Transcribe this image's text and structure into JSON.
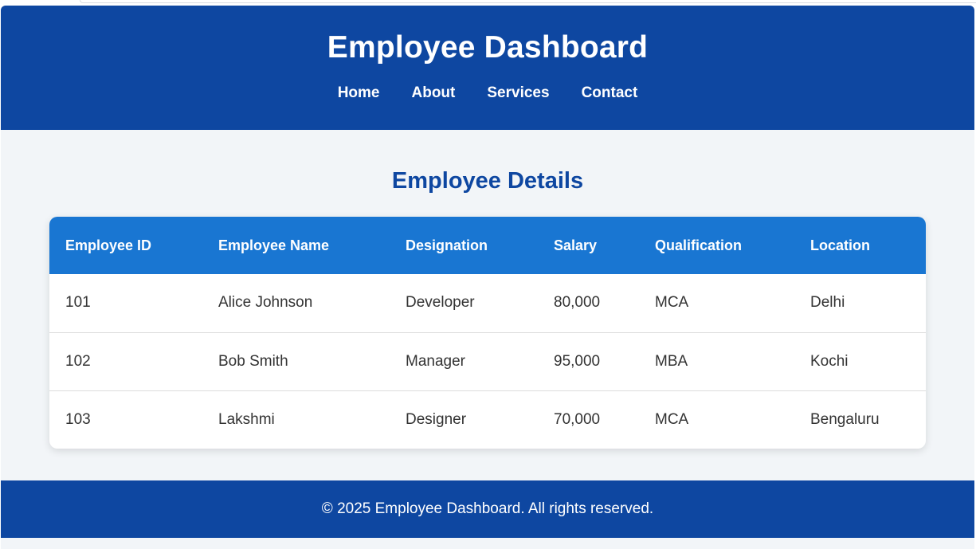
{
  "header": {
    "title": "Employee Dashboard",
    "nav": [
      {
        "label": "Home"
      },
      {
        "label": "About"
      },
      {
        "label": "Services"
      },
      {
        "label": "Contact"
      }
    ]
  },
  "main": {
    "section_title": "Employee Details",
    "table": {
      "columns": [
        "Employee ID",
        "Employee Name",
        "Designation",
        "Salary",
        "Qualification",
        "Location"
      ],
      "rows": [
        [
          "101",
          "Alice Johnson",
          "Developer",
          "80,000",
          "MCA",
          "Delhi"
        ],
        [
          "102",
          "Bob Smith",
          "Manager",
          "95,000",
          "MBA",
          "Kochi"
        ],
        [
          "103",
          "Lakshmi",
          "Designer",
          "70,000",
          "MCA",
          "Bengaluru"
        ]
      ]
    }
  },
  "footer": {
    "text": "© 2025 Employee Dashboard. All rights reserved."
  },
  "colors": {
    "header_bg": "#0e47a1",
    "table_header_bg": "#1976d2",
    "page_bg": "#f2f5f8"
  }
}
